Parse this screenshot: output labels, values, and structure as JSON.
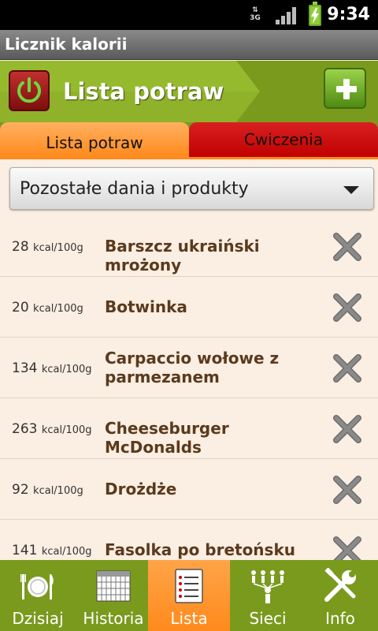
{
  "status_bar": {
    "network": "3G",
    "time": "9:34"
  },
  "app": {
    "title": "Licznik kalorii"
  },
  "header": {
    "title": "Lista potraw",
    "power_icon": "power-icon",
    "add_icon": "plus-icon"
  },
  "tabs": [
    {
      "label": "Lista potraw",
      "active": true
    },
    {
      "label": "Cwiczenia",
      "active": false
    }
  ],
  "category_select": {
    "value": "Pozostałe dania i produkty"
  },
  "items": [
    {
      "kcal": "28",
      "unit": "kcal/100g",
      "name": "Barszcz ukraiński mrożony"
    },
    {
      "kcal": "20",
      "unit": "kcal/100g",
      "name": "Botwinka"
    },
    {
      "kcal": "134",
      "unit": "kcal/100g",
      "name": "Carpaccio wołowe z parmezanem"
    },
    {
      "kcal": "263",
      "unit": "kcal/100g",
      "name": "Cheeseburger McDonalds"
    },
    {
      "kcal": "92",
      "unit": "kcal/100g",
      "name": "Drożdże"
    },
    {
      "kcal": "141",
      "unit": "kcal/100g",
      "name": "Fasolka po bretońsku"
    }
  ],
  "bottom_nav": [
    {
      "label": "Dzisiaj",
      "icon": "plate-cutlery-icon",
      "active": false
    },
    {
      "label": "Historia",
      "icon": "calendar-icon",
      "active": false
    },
    {
      "label": "Lista",
      "icon": "list-icon",
      "active": true
    },
    {
      "label": "Sieci",
      "icon": "network-people-icon",
      "active": false
    },
    {
      "label": "Info",
      "icon": "tools-icon",
      "active": false
    }
  ],
  "colors": {
    "header_green": "#7a9a1e",
    "active_orange": "#ff8a1c",
    "tab_red": "#c00000",
    "list_bg": "#fbeee2",
    "item_name": "#5a3a1e"
  }
}
